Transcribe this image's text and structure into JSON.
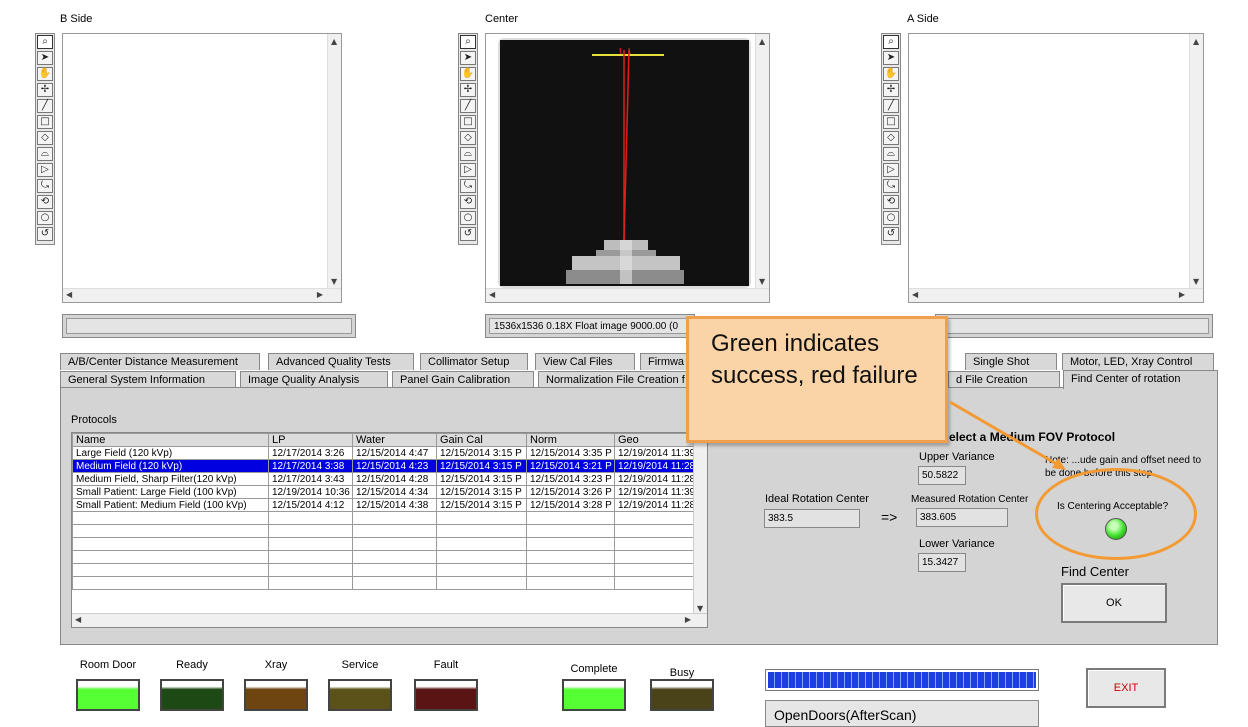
{
  "panels": {
    "b_side": {
      "title": "B Side",
      "status": ""
    },
    "center": {
      "title": "Center",
      "status": "1536x1536 0.18X Float image 9000.00",
      "status_suffix": "(0"
    },
    "a_side": {
      "title": "A Side",
      "status": ""
    }
  },
  "tools": [
    "zoom-icon",
    "pointer-icon",
    "pan-icon",
    "crosshair-icon",
    "line-icon",
    "rectangle-icon",
    "rotated-rectangle-icon",
    "annulus-icon",
    "polygon-icon",
    "freehand-icon",
    "broken-line-icon",
    "oval-icon",
    "spiral-icon"
  ],
  "tools_glyphs": [
    "⌕",
    "➤",
    "✋",
    "✢",
    "╱",
    "□",
    "◇",
    "⌓",
    "▷",
    "⤿",
    "⟲",
    "○",
    "↺"
  ],
  "tabs": {
    "back_row": [
      "A/B/Center Distance Measurement",
      "Advanced Quality Tests",
      "Collimator Setup",
      "View Cal Files",
      "Firmwa",
      "",
      "Single Shot",
      "Motor, LED, Xray Control"
    ],
    "front_row": [
      "General System Information",
      "Image Quality Analysis",
      "Panel Gain Calibration",
      "Normalization File Creation f",
      "",
      "d File Creation",
      "Find Center of rotation"
    ]
  },
  "protocols": {
    "label": "Protocols",
    "columns": [
      "Name",
      "LP",
      "Water",
      "Gain Cal",
      "Norm",
      "Geo"
    ],
    "rows": [
      [
        "Large Field (120 kVp)",
        "12/17/2014 3:26",
        "12/15/2014 4:47",
        "12/15/2014 3:15 P",
        "12/15/2014 3:35 P",
        "12/19/2014 11:39"
      ],
      [
        "Medium Field (120 kVp)",
        "12/17/2014 3:38",
        "12/15/2014 4:23",
        "12/15/2014 3:15 P",
        "12/15/2014 3:21 P",
        "12/19/2014 11:28"
      ],
      [
        "Medium Field, Sharp Filter(120 kVp)",
        "12/17/2014 3:43",
        "12/15/2014 4:28",
        "12/15/2014 3:15 P",
        "12/15/2014 3:23 P",
        "12/19/2014 11:28"
      ],
      [
        "Small Patient: Large Field (100 kVp)",
        "12/19/2014 10:36",
        "12/15/2014 4:34",
        "12/15/2014 3:15 P",
        "12/15/2014 3:26 P",
        "12/19/2014 11:39"
      ],
      [
        "Small Patient: Medium Field (100 kVp)",
        "12/15/2014 4:12",
        "12/15/2014 4:38",
        "12/15/2014 3:15 P",
        "12/15/2014 3:28 P",
        "12/19/2014 11:28"
      ]
    ],
    "selected_index": 1
  },
  "center_find": {
    "protocol_note": "elect a Medium FOV Protocol",
    "upper_variance_label": "Upper Variance",
    "upper_variance": "50.5822",
    "ideal_label": "Ideal Rotation Center",
    "ideal_value": "383.5",
    "arrow": "=>",
    "measured_label": "Measured Rotation Center",
    "measured_value": "383.605",
    "lower_variance_label": "Lower Variance",
    "lower_variance": "15.3427",
    "note": "Note: ...ude gain and offset need to be done before this step",
    "acceptable_label": "Is Centering Acceptable?",
    "acceptable_led_color": "#3fe02a",
    "find_center_label": "Find Center",
    "ok_label": "OK"
  },
  "callout": {
    "text": "Green indicates success, red failure"
  },
  "indicators": [
    {
      "label": "Room Door",
      "color": "#55ff33"
    },
    {
      "label": "Ready",
      "color": "#1d4a14"
    },
    {
      "label": "Xray",
      "color": "#6e4410"
    },
    {
      "label": "Service",
      "color": "#5a5218"
    },
    {
      "label": "Fault",
      "color": "#5a1414"
    },
    {
      "label": "Complete",
      "color": "#55ff33"
    },
    {
      "label": "Busy",
      "color": "#4a4218"
    }
  ],
  "progress": {
    "fraction": 1.0,
    "color": "#1d3fe0"
  },
  "status_message": "OpenDoors(AfterScan)",
  "exit_label": "EXIT"
}
